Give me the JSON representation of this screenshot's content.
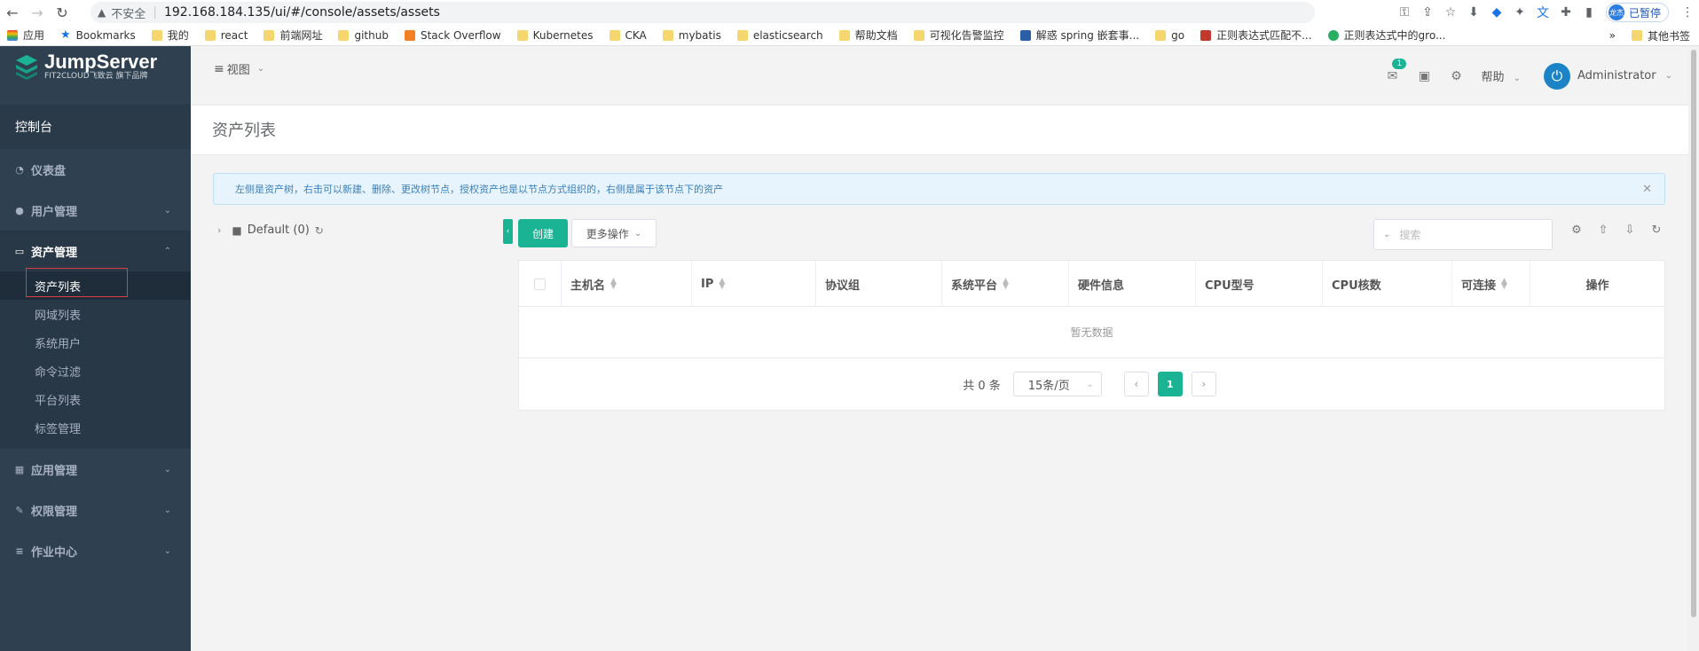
{
  "browser": {
    "url_warning": "不安全",
    "url": "192.168.184.135/ui/#/console/assets/assets",
    "profile_initials": "龙杰",
    "profile_status": "已暂停"
  },
  "bookmarks": {
    "items": [
      "应用",
      "Bookmarks",
      "我的",
      "react",
      "前端网址",
      "github",
      "Stack Overflow",
      "Kubernetes",
      "CKA",
      "mybatis",
      "elasticsearch",
      "帮助文档",
      "可视化告警监控",
      "解惑 spring 嵌套事...",
      "go",
      "正则表达式匹配不...",
      "正则表达式中的gro..."
    ],
    "overflow": "»",
    "other": "其他书签"
  },
  "sidebar": {
    "brand_name": "JumpServer",
    "brand_sub": "FIT2CLOUD飞致云 旗下品牌",
    "console": "控制台",
    "menu": [
      {
        "label": "仪表盘",
        "icon": "dashboard-icon"
      },
      {
        "label": "用户管理",
        "icon": "users-icon"
      },
      {
        "label": "资产管理",
        "icon": "assets-icon"
      },
      {
        "label": "应用管理",
        "icon": "grid-icon"
      },
      {
        "label": "权限管理",
        "icon": "edit-icon"
      },
      {
        "label": "作业中心",
        "icon": "list-icon"
      }
    ],
    "submenu": [
      "资产列表",
      "网域列表",
      "系统用户",
      "命令过滤",
      "平台列表",
      "标签管理"
    ]
  },
  "topbar": {
    "view": "视图",
    "badge_count": "1",
    "help": "帮助",
    "user": "Administrator"
  },
  "page": {
    "title": "资产列表",
    "alert": "左侧是资产树，右击可以新建、删除、更改树节点，授权资产也是以节点方式组织的，右侧是属于该节点下的资产",
    "tree_node": "Default (0)",
    "create": "创建",
    "more": "更多操作",
    "search_placeholder": "搜索"
  },
  "table": {
    "columns": [
      "主机名",
      "IP",
      "协议组",
      "系统平台",
      "硬件信息",
      "CPU型号",
      "CPU核数",
      "可连接",
      "操作"
    ],
    "empty": "暂无数据",
    "total": "共 0 条",
    "page_size": "15条/页",
    "current_page": "1"
  },
  "colors": {
    "accent": "#1ab394",
    "sidebar": "#2f4050"
  }
}
